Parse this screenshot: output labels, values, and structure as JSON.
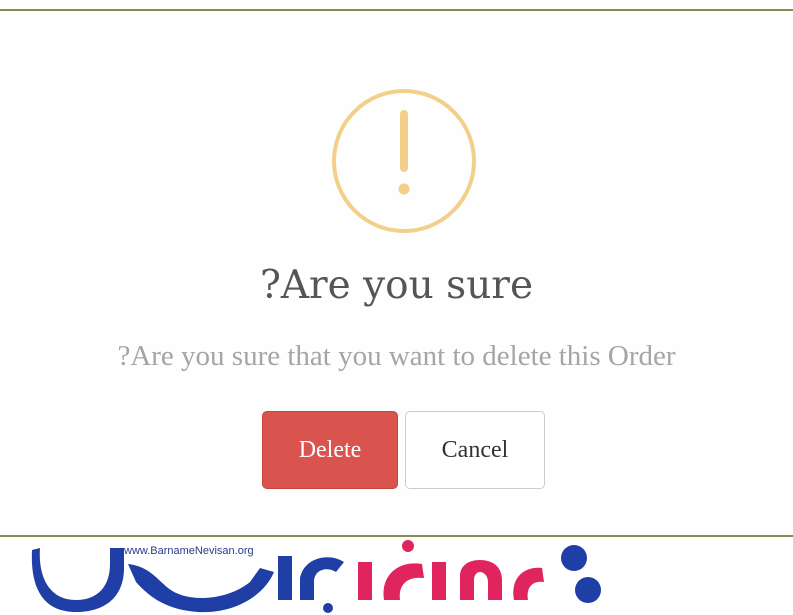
{
  "dialog": {
    "icon": "exclamation-circle-icon",
    "icon_color": "#f3d08a",
    "title": "?Are you sure",
    "message": "?Are you sure that you want to delete this Order",
    "delete_label": "Delete",
    "cancel_label": "Cancel",
    "delete_color": "#d9534f"
  },
  "watermark": {
    "url": "www.BarnameNevisan.org",
    "brand_blue": "#1f3fa6",
    "brand_pink": "#e0245e"
  }
}
